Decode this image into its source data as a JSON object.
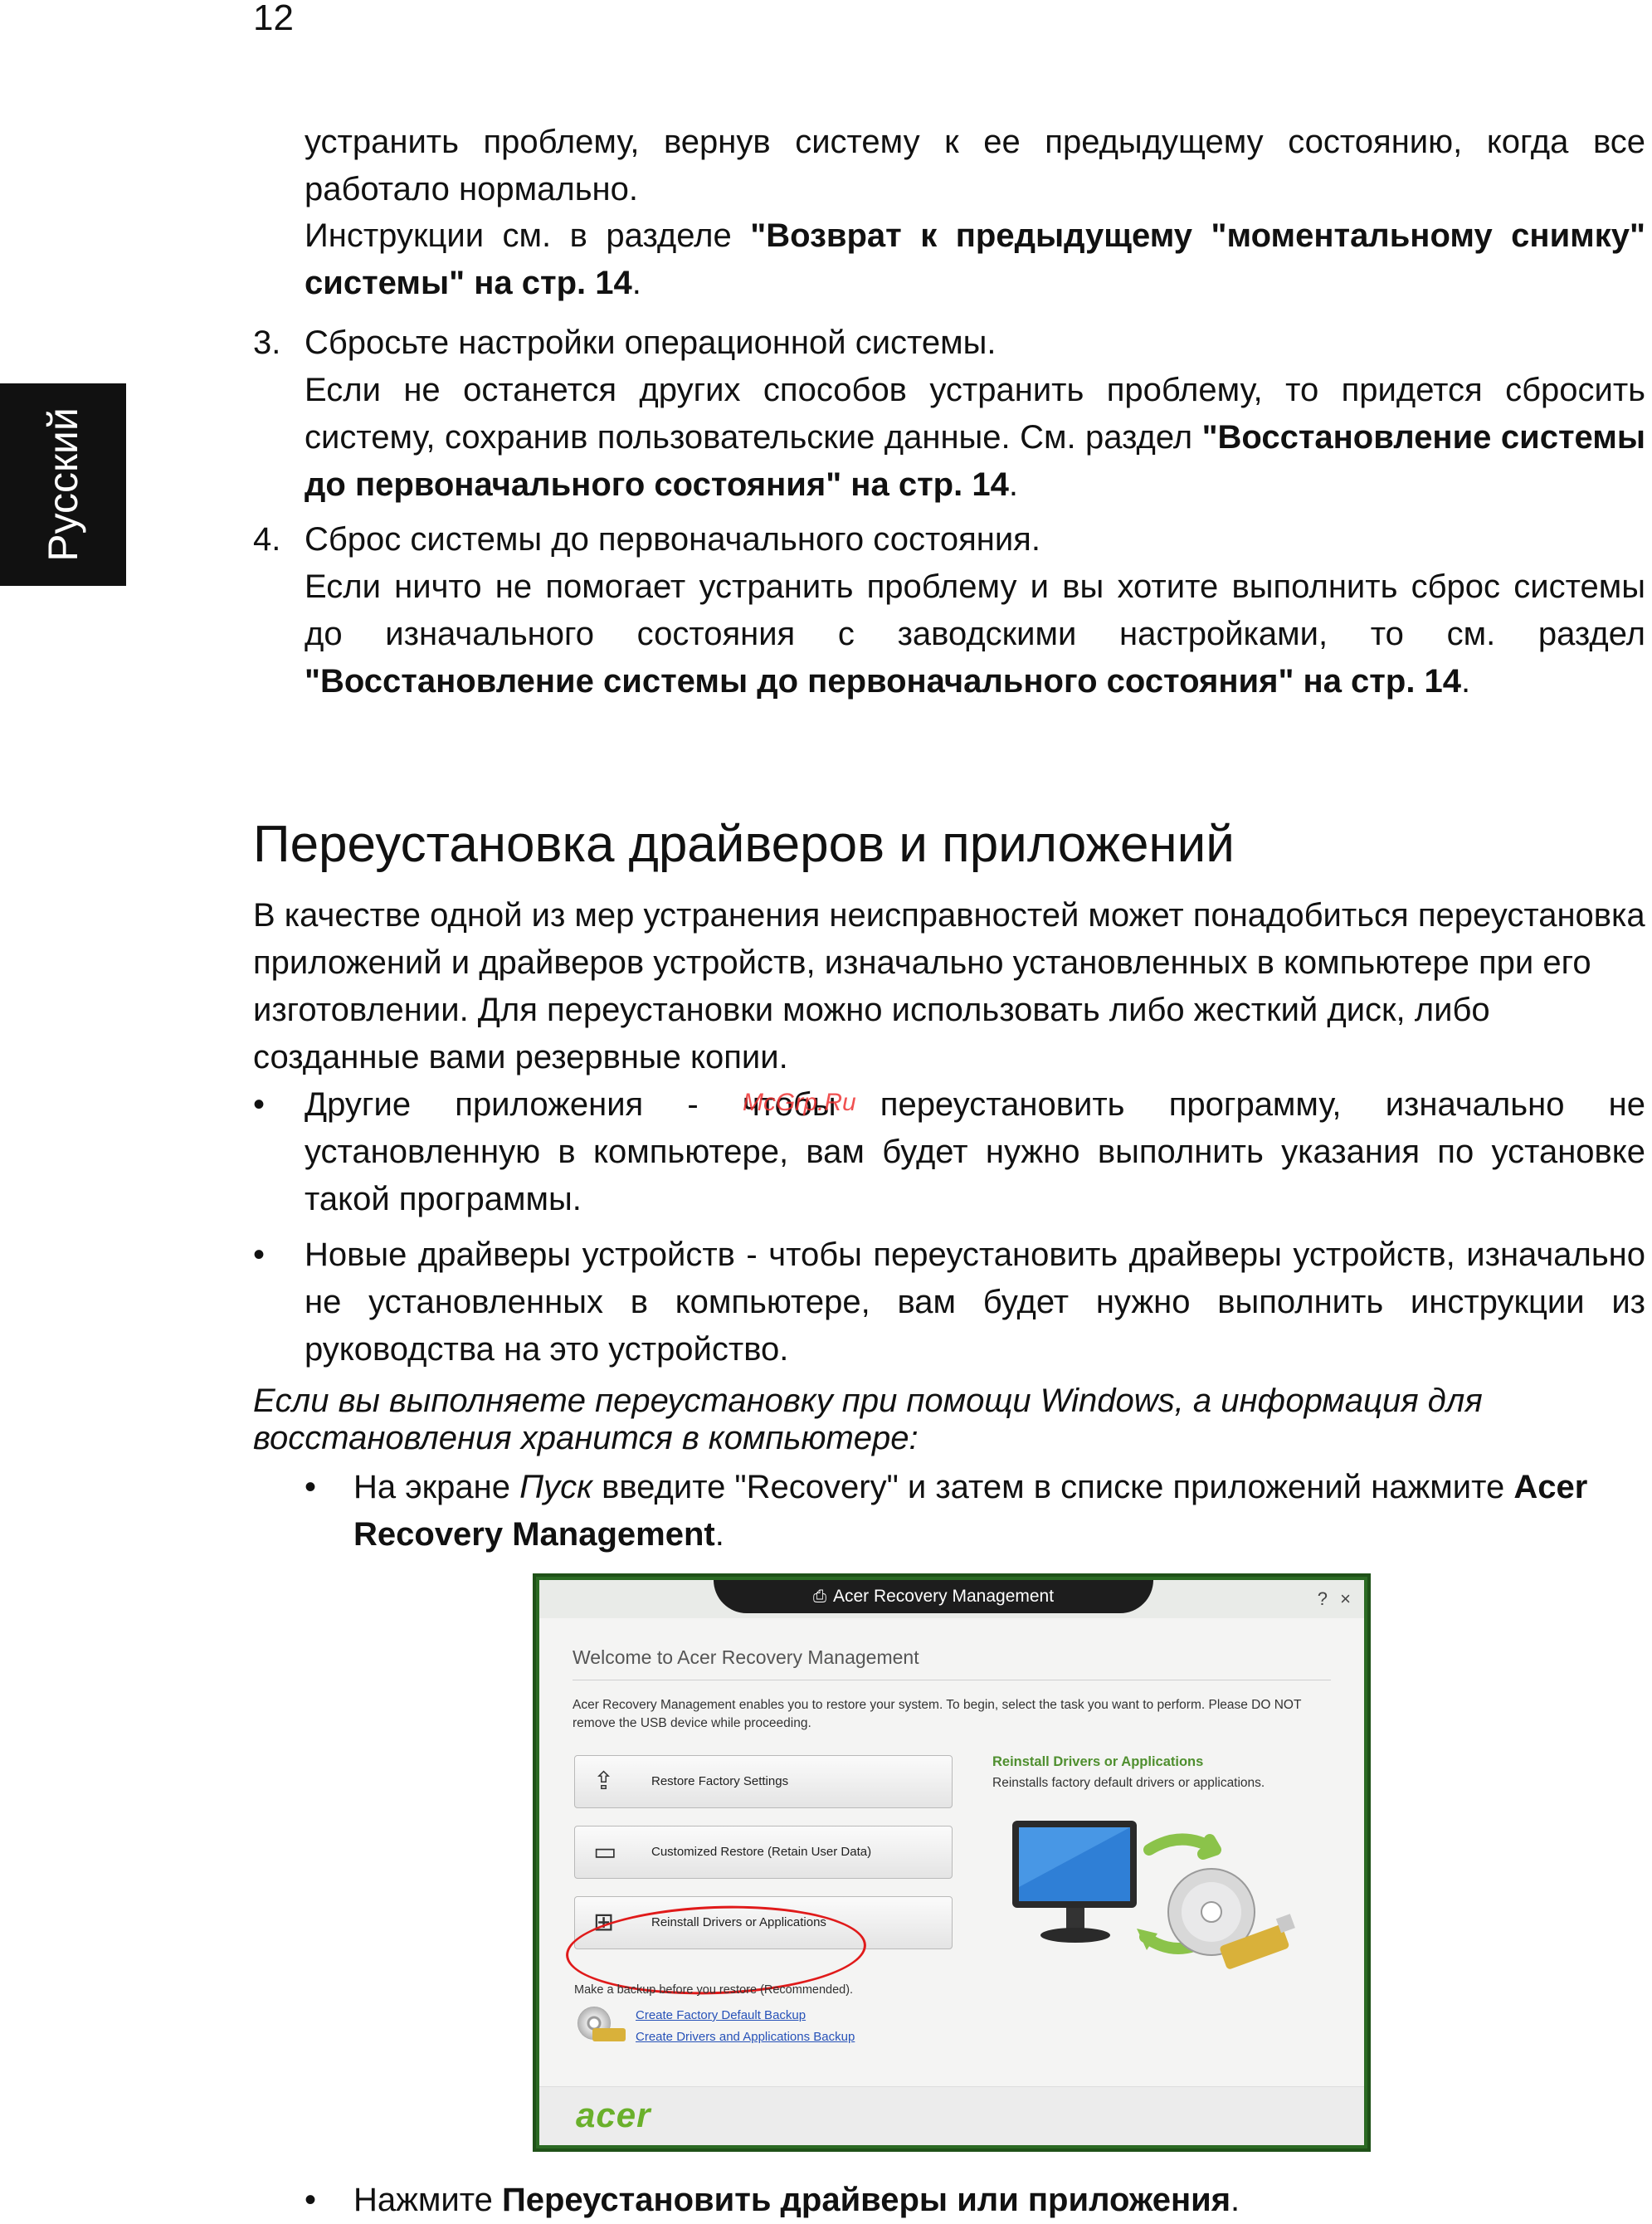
{
  "page": {
    "number": "12",
    "side_tab": "Русский"
  },
  "list_continuation": {
    "line1": "устранить проблему, вернув систему к ее предыдущему состоянию, когда все работало нормально.",
    "line2_prefix": "Инструкции см. в разделе ",
    "line2_bold": "\"Возврат к предыдущему \"моментальному снимку\" системы\" на стр. 14",
    "line2_suffix": "."
  },
  "numbered_items": [
    {
      "number": "3.",
      "title": "Сбросьте настройки операционной системы.",
      "text": "Если не останется других способов устранить проблему, то придется сбросить систему, сохранив пользовательские данные. См. раздел ",
      "bold": "\"Восстановление системы до первоначального состояния\" на стр. 14",
      "suffix": "."
    },
    {
      "number": "4.",
      "title": "Сброс системы до первоначального состояния.",
      "text": "Если ничто не помогает устранить проблему и вы хотите выполнить сброс системы до изначального состояния с заводскими настройками, то см. раздел ",
      "bold": "\"Восстановление системы до первоначального состояния\" на стр. 14",
      "suffix": "."
    }
  ],
  "section": {
    "heading": "Переустановка драйверов и приложений",
    "intro": "В качестве одной из мер устранения неисправностей может понадобиться переустановка приложений и драйверов устройств, изначально установленных в компьютере при его изготовлении. Для переустановки можно использовать либо жесткий диск, либо созданные вами резервные копии.",
    "bullets": [
      "Другие приложения - чтобы переустановить программу, изначально не установленную в компьютере, вам будет нужно выполнить указания по установке такой программы.",
      "Новые драйверы устройств - чтобы переустановить драйверы устройств, изначально не установленных в компьютере, вам будет нужно выполнить инструкции из руководства на это устройство."
    ],
    "italic_note": "Если вы выполняете переустановку при помощи Windows, а информация для восстановления хранится в компьютере:",
    "step1_prefix": "На экране ",
    "step1_italic": "Пуск",
    "step1_middle": " введите \"Recovery\" и затем в списке приложений нажмите ",
    "step1_bold": "Acer Recovery Management",
    "step1_suffix": ".",
    "step2_prefix": "Нажмите ",
    "step2_bold": "Переустановить драйверы или приложения",
    "step2_suffix": ".",
    "bullet_glyph": "•"
  },
  "watermark": "McGrp.Ru",
  "screenshot": {
    "title": "Acer Recovery Management",
    "help": "?",
    "close": "×",
    "welcome": "Welcome to Acer Recovery Management",
    "description": "Acer Recovery Management enables you to restore your system. To begin, select the task you want to perform. Please DO NOT remove the USB device while proceeding.",
    "buttons": [
      {
        "label": "Restore Factory Settings",
        "icon": "restore-icon"
      },
      {
        "label": "Customized Restore (Retain User Data)",
        "icon": "drive-icon"
      },
      {
        "label": "Reinstall Drivers or Applications",
        "icon": "reinstall-icon"
      }
    ],
    "right_title": "Reinstall Drivers or Applications",
    "right_desc": "Reinstalls factory default drivers or applications.",
    "backup_note": "Make a backup before you restore (Recommended).",
    "links": [
      "Create Factory Default Backup",
      "Create Drivers and Applications Backup"
    ],
    "logo": "acer",
    "colors": {
      "accent_green": "#4f8f2f",
      "link_blue": "#2752b8",
      "highlight_red": "#e01a1a",
      "frame_green": "#2b6a23"
    }
  }
}
